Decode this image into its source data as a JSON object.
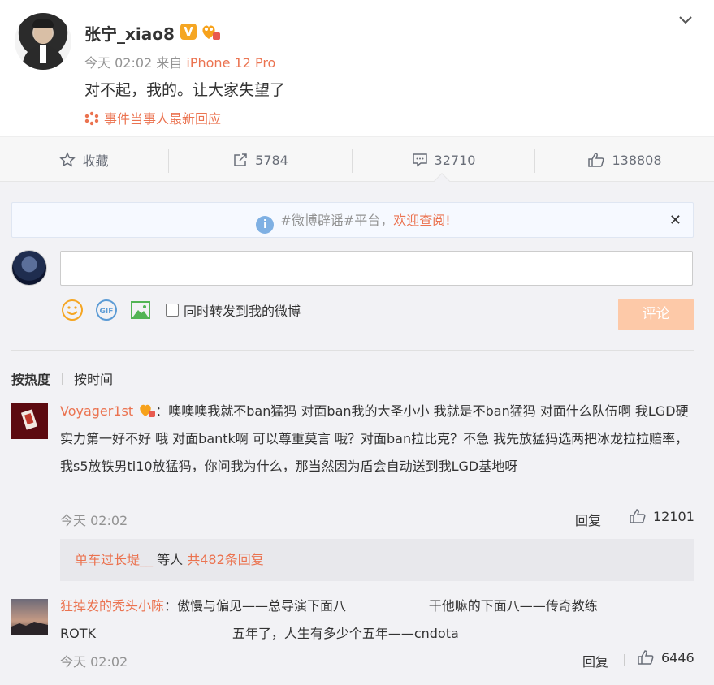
{
  "post": {
    "username": "张宁_xiao8",
    "v_badge": "V",
    "time": "今天 02:02",
    "from_label": "来自",
    "device": "iPhone 12 Pro",
    "content": "对不起，我的。让大家失望了",
    "event_link": "事件当事人最新回应"
  },
  "actions": {
    "favorite": "收藏",
    "reposts": "5784",
    "comments": "32710",
    "likes": "138808"
  },
  "rumor_banner": {
    "prefix": "#微博辟谣#平台，",
    "link": "欢迎查阅!",
    "close": "✕"
  },
  "composer": {
    "repost_label": "同时转发到我的微博",
    "submit": "评论"
  },
  "sort": {
    "hot": "按热度",
    "time": "按时间"
  },
  "comments": [
    {
      "user": "Voyager1st",
      "text": "：噢噢噢我就不ban猛犸 对面ban我的大圣小小 我就是不ban猛犸 对面什么队伍啊 我LGD硬实力第一好不好  哦 对面bantk啊 可以尊重莫言 哦？对面ban拉比克？不急 我先放猛犸选两把冰龙拉拉赔率，我s5放铁男ti10放猛犸，你问我为什么，那当然因为盾会自动送到我LGD基地呀",
      "time": "今天 02:02",
      "reply": "回复",
      "likes": "12101",
      "sub": {
        "user": "单车过长堤__",
        "mid": " 等人 ",
        "count": "共482条回复"
      }
    },
    {
      "user": "狂掉发的秃头小陈",
      "text_line1": "：傲慢与偏见——总导演下面八                    干他嘛的下面八——传奇教练",
      "text_line2": "ROTK                                 五年了，人生有多少个五年——cndota",
      "time": "今天 02:02",
      "reply": "回复",
      "likes": "6446"
    }
  ]
}
